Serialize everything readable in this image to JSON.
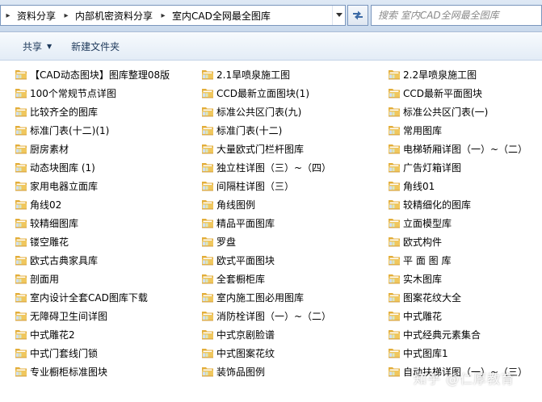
{
  "address": {
    "breadcrumbs": [
      "资料分享",
      "内部机密资料分享",
      "室内CAD全网最全图库"
    ]
  },
  "search": {
    "placeholder": "搜索 室内CAD全网最全图库"
  },
  "toolbar": {
    "share_label": "共享",
    "new_folder_label": "新建文件夹"
  },
  "columns": [
    [
      "【CAD动态图块】图库整理08版",
      "100个常规节点详图",
      "比较齐全的图库",
      "标准门表(十二)(1)",
      "厨房素材",
      "动态块图库 (1)",
      "家用电器立面库",
      "角线02",
      "较精细图库",
      "镂空雕花",
      "欧式古典家具库",
      "剖面用",
      "室内设计全套CAD图库下载",
      "无障碍卫生间详图",
      "中式雕花2",
      "中式门套线门锁",
      "专业橱柜标准图块"
    ],
    [
      "2.1旱喷泉施工图",
      "CCD最新立面图块(1)",
      "标准公共区门表(九)",
      "标准门表(十二)",
      "大量欧式门栏杆图库",
      "独立柱详图（三）~（四）",
      "间隔柱详图（三）",
      "角线图例",
      "精品平面图库",
      "罗盘",
      "欧式平面图块",
      "全套橱柜库",
      "室内施工图必用图库",
      "消防栓详图（一）~（二）",
      "中式京剧脸谱",
      "中式图案花纹",
      "装饰品图例"
    ],
    [
      "2.2旱喷泉施工图",
      "CCD最新平面图块",
      "标准公共区门表(一)",
      "常用图库",
      "电梯轿厢详图（一）~（二）",
      "广告灯箱详图",
      "角线01",
      "较精细化的图库",
      "立面模型库",
      "欧式构件",
      "平 面 图 库",
      "实木图库",
      "图案花纹大全",
      "中式雕花",
      "中式经典元素集合",
      "中式图库1",
      "自动扶梯详图（一）~（三）"
    ]
  ],
  "watermark": "知乎 @仁厚教育",
  "colors": {
    "folder_body": "#f0c75e",
    "folder_tab": "#e3ae3a",
    "folder_paper": "#ffffff",
    "accent": "#1e395b"
  }
}
